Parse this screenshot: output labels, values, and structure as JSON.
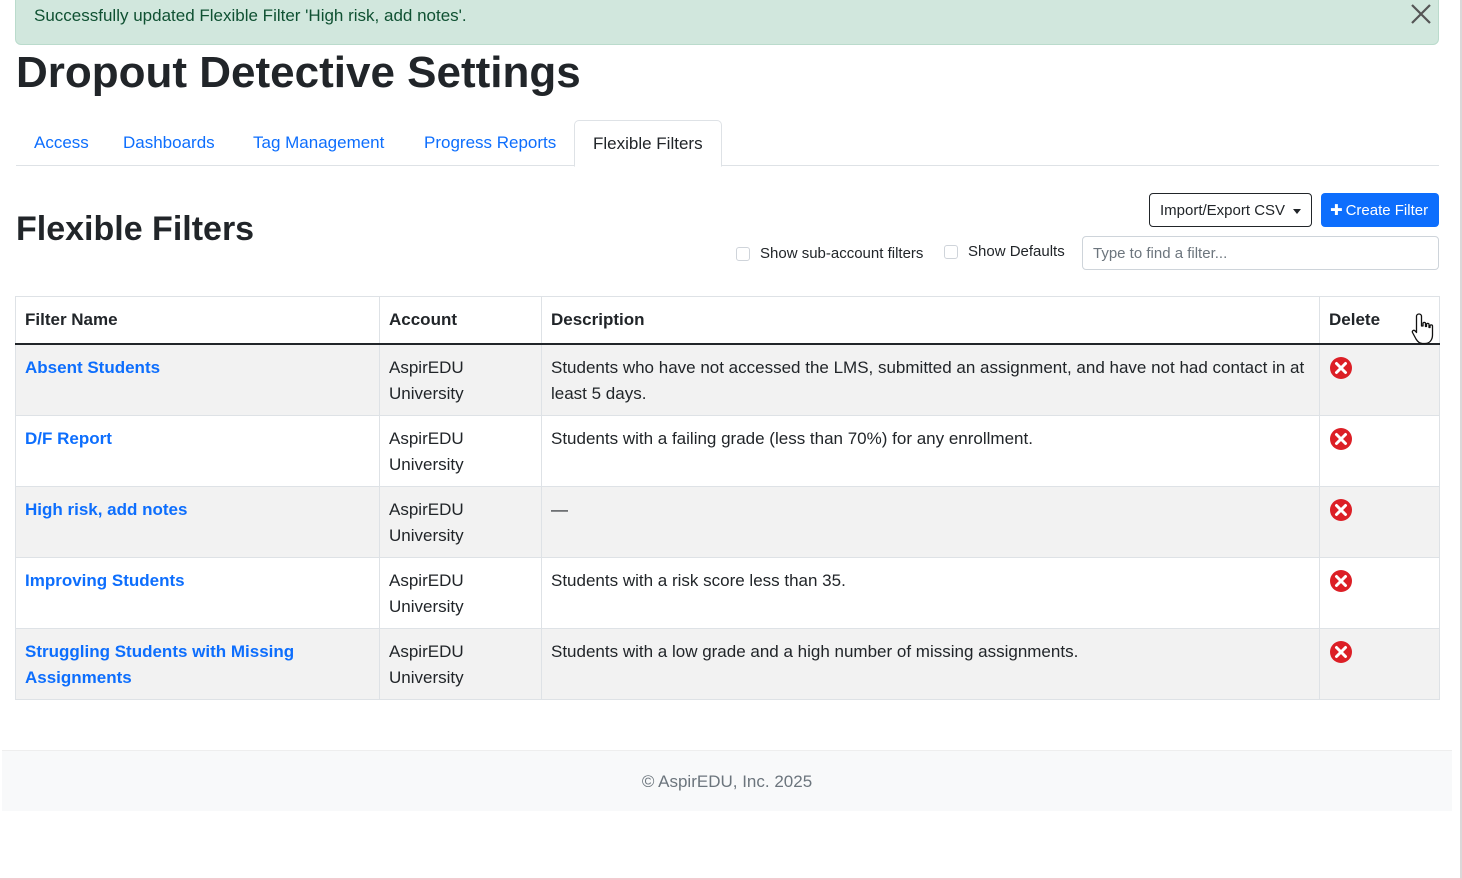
{
  "alert": {
    "message": "Successfully updated Flexible Filter 'High risk, add notes'.",
    "close_icon": "close-icon",
    "color": "#d1e7dd"
  },
  "page_title": "Dropout Detective Settings",
  "tabs": [
    {
      "label": "Access",
      "active": false
    },
    {
      "label": "Dashboards",
      "active": false
    },
    {
      "label": "Tag Management",
      "active": false
    },
    {
      "label": "Progress Reports",
      "active": false
    },
    {
      "label": "Flexible Filters",
      "active": true
    }
  ],
  "section": {
    "title": "Flexible Filters",
    "import_export_label": "Import/Export CSV",
    "create_label": "Create Filter",
    "create_icon": "plus-icon",
    "show_sub_account_label": "Show sub-account filters",
    "show_sub_account_checked": false,
    "show_defaults_label": "Show Defaults",
    "show_defaults_checked": false,
    "search_placeholder": "Type to find a filter...",
    "search_value": ""
  },
  "table": {
    "headers": [
      "Filter Name",
      "Account",
      "Description",
      "Delete"
    ],
    "rows": [
      {
        "name": "Absent Students",
        "account": "AspirEDU University",
        "description": "Students who have not accessed the LMS, submitted an assignment, and have not had contact in at least 5 days."
      },
      {
        "name": "D/F Report",
        "account": "AspirEDU University",
        "description": "Students with a failing grade (less than 70%) for any enrollment."
      },
      {
        "name": "High risk, add notes",
        "account": "AspirEDU University",
        "description": "—"
      },
      {
        "name": "Improving Students",
        "account": "AspirEDU University",
        "description": "Students with a risk score less than 35."
      },
      {
        "name": "Struggling Students with Missing Assignments",
        "account": "AspirEDU University",
        "description": "Students with a low grade and a high number of missing assignments."
      }
    ],
    "delete_icon": "x-circle-icon"
  },
  "footer": {
    "text": "© AspirEDU, Inc. 2025"
  },
  "colors": {
    "link": "#0d6efd",
    "primary_button": "#0d6efd",
    "delete": "#dc1f26",
    "stripe": "#f2f2f2"
  }
}
